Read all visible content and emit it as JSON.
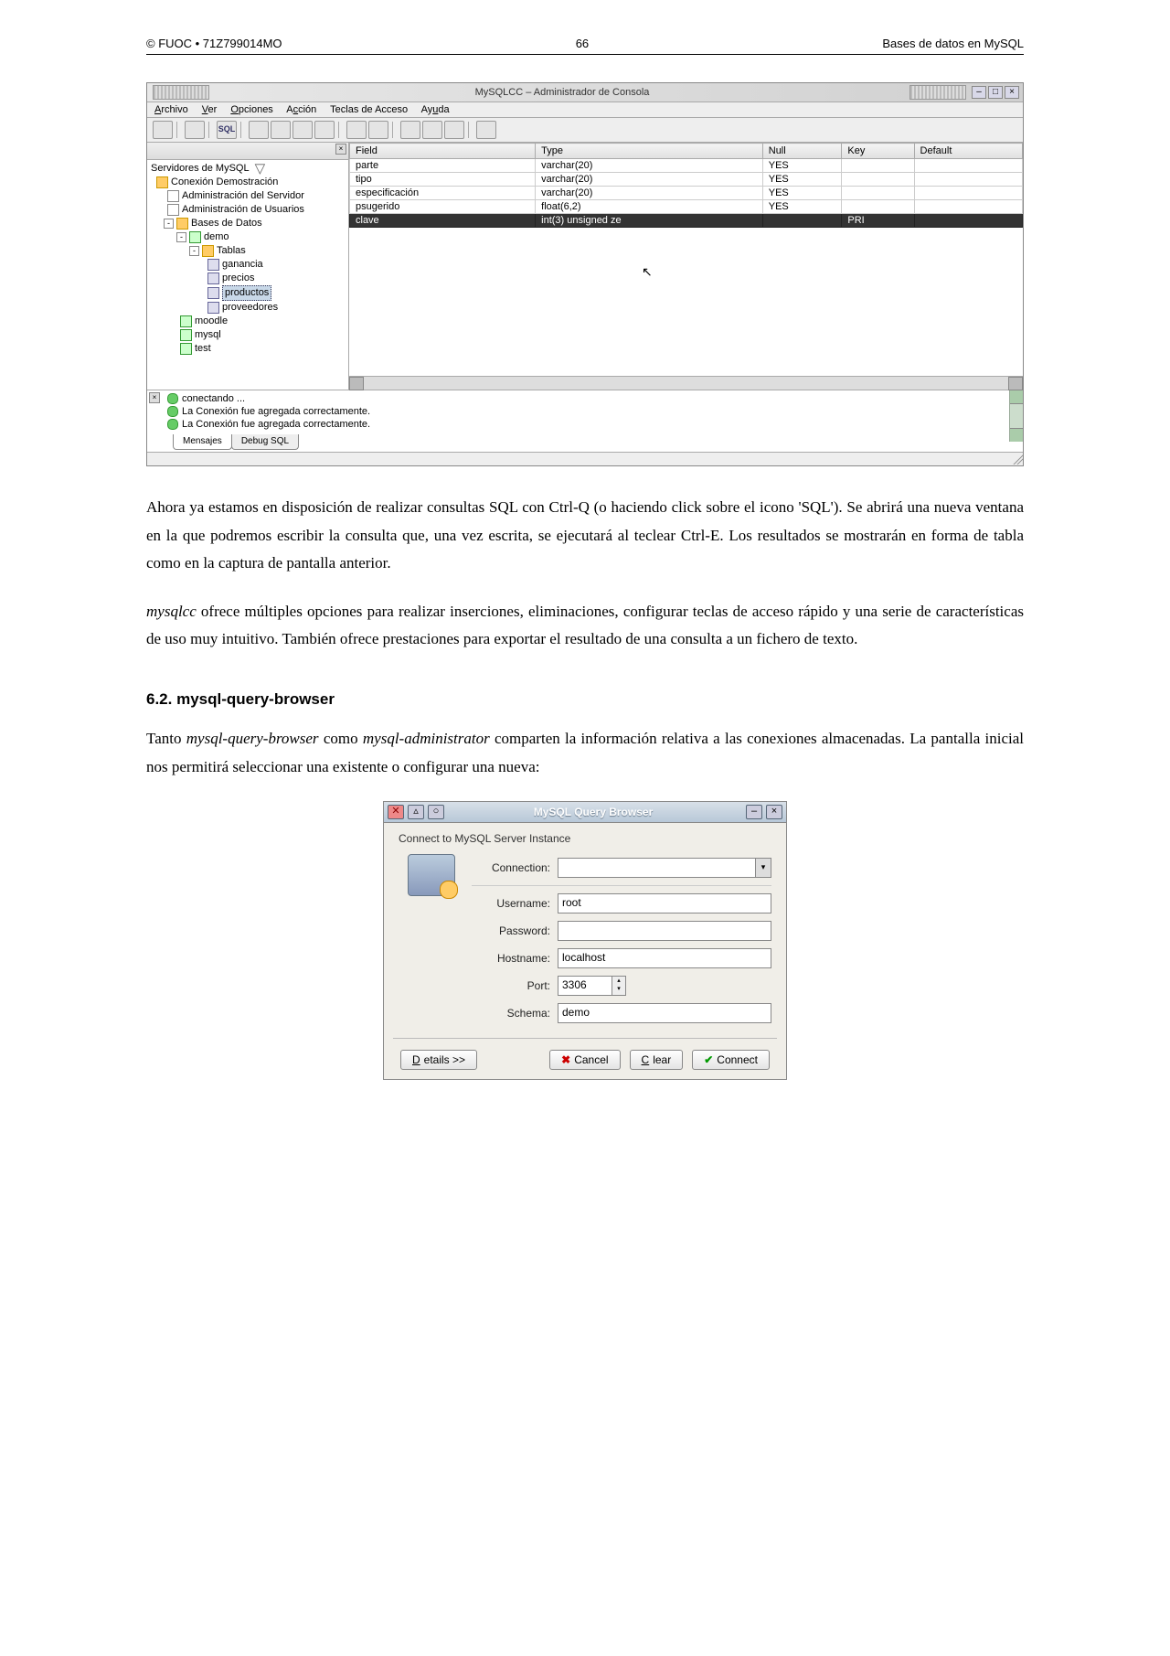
{
  "header": {
    "left": "© FUOC • 71Z799014MO",
    "center": "66",
    "right": "Bases de datos en MySQL"
  },
  "mysqlcc": {
    "title": "MySQLCC – Administrador de Consola",
    "menu": {
      "archivo": "Archivo",
      "ver": "Ver",
      "opciones": "Opciones",
      "accion": "Acción",
      "teclas": "Teclas de Acceso",
      "ayuda": "Ayuda"
    },
    "tree": {
      "root": "Servidores de MySQL",
      "conn": "Conexión Demostración",
      "admServ": "Administración del Servidor",
      "admUsr": "Administración de Usuarios",
      "bd": "Bases de Datos",
      "demo": "demo",
      "tablas": "Tablas",
      "ganancia": "ganancia",
      "precios": "precios",
      "productos": "productos",
      "proveedores": "proveedores",
      "moodle": "moodle",
      "mysql": "mysql",
      "test": "test"
    },
    "grid": {
      "headers": {
        "field": "Field",
        "type": "Type",
        "null": "Null",
        "key": "Key",
        "default": "Default"
      },
      "rows": [
        {
          "field": "parte",
          "type": "varchar(20)",
          "null": "YES",
          "key": "",
          "default": ""
        },
        {
          "field": "tipo",
          "type": "varchar(20)",
          "null": "YES",
          "key": "",
          "default": ""
        },
        {
          "field": "especificación",
          "type": "varchar(20)",
          "null": "YES",
          "key": "",
          "default": ""
        },
        {
          "field": "psugerido",
          "type": "float(6,2)",
          "null": "YES",
          "key": "",
          "default": ""
        },
        {
          "field": "clave",
          "type": "int(3) unsigned ze",
          "null": "",
          "key": "PRI",
          "default": ""
        }
      ]
    },
    "messages": {
      "m1": "conectando ...",
      "m2": "La Conexión fue agregada correctamente.",
      "m3": "La Conexión fue agregada correctamente.",
      "tab1": "Mensajes",
      "tab2": "Debug SQL"
    }
  },
  "para1": "Ahora ya estamos en disposición de realizar consultas SQL con Ctrl-Q (o haciendo click sobre el icono 'SQL'). Se abrirá una nueva ventana en la que podremos escribir la consulta que, una vez escrita, se ejecutará al teclear Ctrl-E. Los resultados se mostrarán en forma de tabla como en la captura de pantalla anterior.",
  "para2_pre": "mysqlcc",
  "para2": " ofrece múltiples opciones para realizar inserciones, eliminaciones, configurar teclas de acceso rápido y una serie de características de uso muy intuitivo. También ofrece prestaciones para exportar el resultado de una consulta a un fichero de texto.",
  "section62": "6.2.  mysql-query-browser",
  "para3_a": "Tanto ",
  "para3_e1": "mysql-query-browser",
  "para3_b": " como ",
  "para3_e2": "mysql-administrator",
  "para3_c": " comparten la información relativa a las conexiones almacenadas. La pantalla inicial nos permitirá seleccionar una existente o configurar una nueva:",
  "qb": {
    "title": "MySQL Query Browser",
    "instance": "Connect to MySQL Server Instance",
    "labels": {
      "connection": "Connection:",
      "username": "Username:",
      "password": "Password:",
      "hostname": "Hostname:",
      "port": "Port:",
      "schema": "Schema:"
    },
    "values": {
      "connection": "",
      "username": "root",
      "password": "",
      "hostname": "localhost",
      "port": "3306",
      "schema": "demo"
    },
    "buttons": {
      "details": "Details >>",
      "cancel": "Cancel",
      "clear": "Clear",
      "connect": "Connect"
    }
  }
}
